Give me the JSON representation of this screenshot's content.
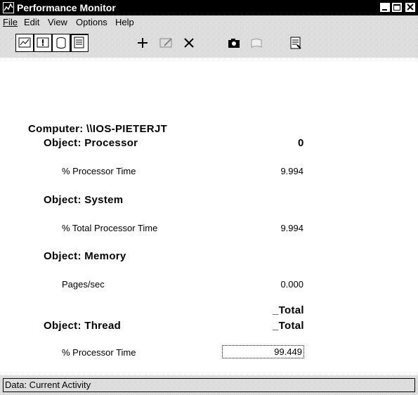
{
  "window": {
    "title": "Performance Monitor",
    "controls": [
      "minimize-icon",
      "maximize-icon",
      "close-icon"
    ]
  },
  "menu": [
    {
      "label": "File",
      "underline_index": 0
    },
    {
      "label": "Edit",
      "underline_index": 0
    },
    {
      "label": "View",
      "underline_index": 0
    },
    {
      "label": "Options",
      "underline_index": 0
    },
    {
      "label": "Help",
      "underline_index": 0
    }
  ],
  "toolbar": {
    "buttons": [
      {
        "name": "chart-view-icon"
      },
      {
        "name": "alert-view-icon"
      },
      {
        "name": "log-view-icon"
      },
      {
        "name": "report-view-icon"
      },
      {
        "name": "add-counter-icon"
      },
      {
        "name": "edit-counter-icon"
      },
      {
        "name": "delete-counter-icon"
      },
      {
        "name": "snapshot-icon"
      },
      {
        "name": "bookmark-icon"
      },
      {
        "name": "options-icon"
      }
    ]
  },
  "report": {
    "computer": "Computer: \\\\IOS-PIETERJT",
    "objects": [
      {
        "label": "Object: Processor",
        "instance": "0",
        "counters": [
          {
            "label": "% Processor Time",
            "value": "9.994"
          }
        ]
      },
      {
        "label": "Object: System",
        "counters": [
          {
            "label": "% Total Processor Time",
            "value": "9.994"
          }
        ]
      },
      {
        "label": "Object: Memory",
        "counters": [
          {
            "label": "Pages/sec",
            "value": "0.000"
          }
        ]
      },
      {
        "label": "Object: Thread",
        "instance_top": "_Total",
        "instance_bottom": "_Total",
        "counters": [
          {
            "label": "% Processor Time",
            "value": "99.449"
          }
        ]
      }
    ]
  },
  "status": {
    "text": "Data: Current Activity"
  }
}
